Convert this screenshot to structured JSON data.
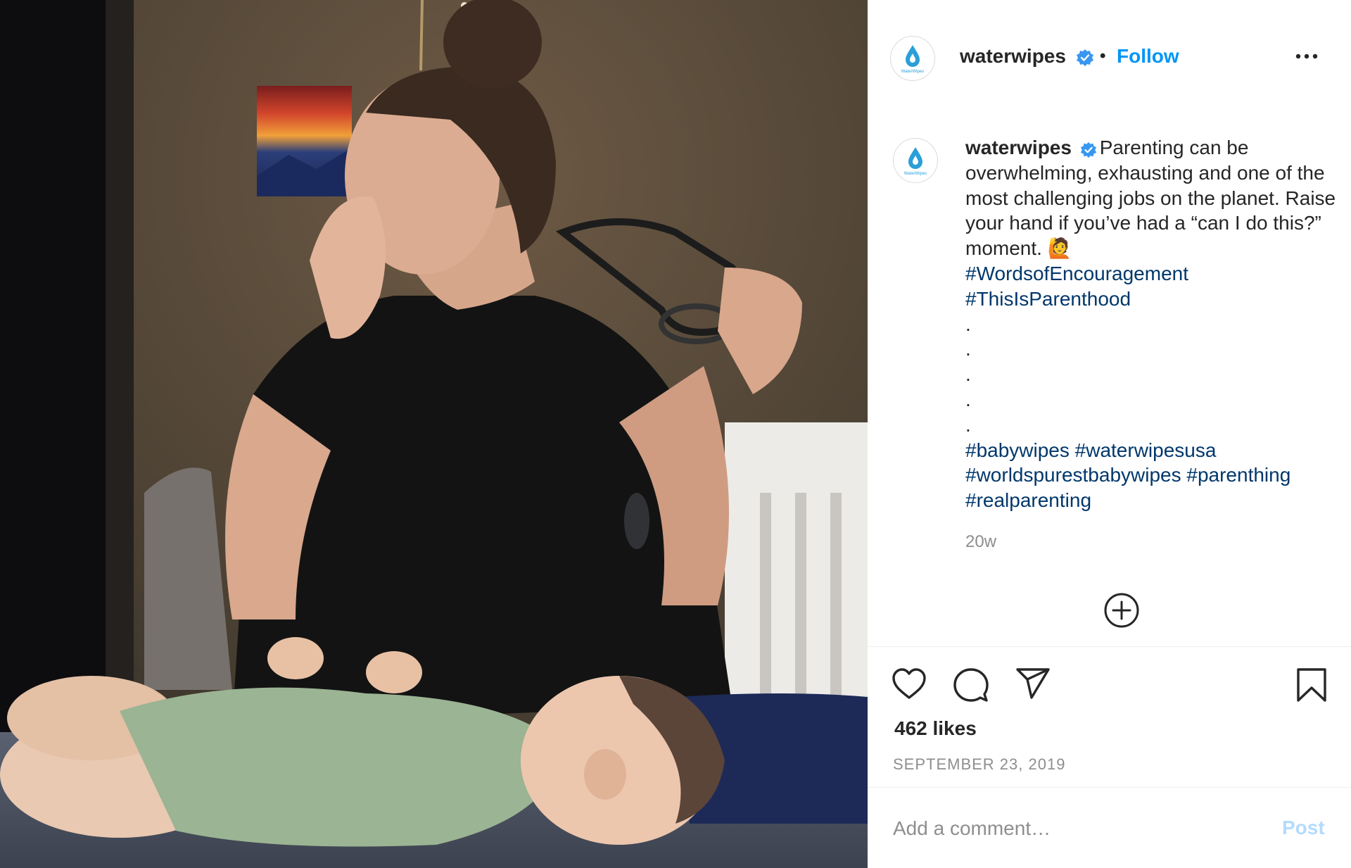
{
  "post": {
    "username": "waterwipes",
    "verified": true,
    "separator": "•",
    "follow_label": "Follow",
    "more_icon": "more-options-icon",
    "avatar_brand_text": "WaterWipes",
    "caption": {
      "username": "waterwipes",
      "text": "Parenting can be overwhelming, exhausting and one of the most challenging jobs on the planet. Raise your hand if you’ve had a “can I do this?” moment. 🙋",
      "hashtags_1": [
        "#WordsofEncouragement",
        "#ThisIsParenthood"
      ],
      "dots": [
        ".",
        ".",
        ".",
        ".",
        "."
      ],
      "hashtags_2": [
        "#babywipes",
        "#waterwipesusa",
        "#worldspurestbabywipes",
        "#parenthing",
        "#realparenting"
      ],
      "time_ago": "20w"
    },
    "load_more_icon": "plus-circle-icon",
    "actions": {
      "like_icon": "heart-icon",
      "comment_icon": "comment-icon",
      "share_icon": "paper-plane-icon",
      "save_icon": "bookmark-icon"
    },
    "likes": "462 likes",
    "date": "SEPTEMBER 23, 2019",
    "comment_placeholder": "Add a comment…",
    "post_label": "Post"
  },
  "colors": {
    "link_blue": "#0095f6",
    "hashtag": "#00376b",
    "muted": "#8e8e8e",
    "post_disabled": "#b3dbff",
    "brand_drop": "#2a9fd8"
  }
}
